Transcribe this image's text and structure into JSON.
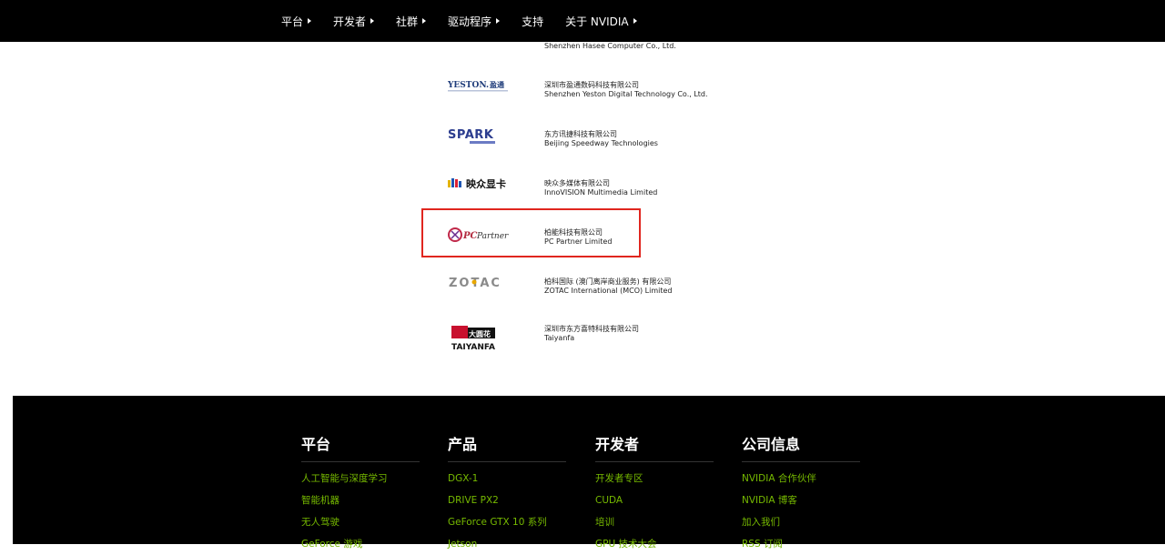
{
  "nav": {
    "items": [
      {
        "label": "平台",
        "caret": true
      },
      {
        "label": "开发者",
        "caret": true
      },
      {
        "label": "社群",
        "caret": true
      },
      {
        "label": "驱动程序",
        "caret": true
      },
      {
        "label": "支持",
        "caret": false
      },
      {
        "label": "关于 NVIDIA",
        "caret": true
      }
    ]
  },
  "partners": {
    "top_partial": "Shenzhen Hasee Computer Co., Ltd.",
    "items": [
      {
        "logo": "YESTON. 盈通",
        "cn": "深圳市盈通数码科技有限公司",
        "en": "Shenzhen Yeston Digital Technology Co., Ltd."
      },
      {
        "logo": "SPARK",
        "cn": "东方讯捷科技有限公司",
        "en": "Beijing Speedway Technologies"
      },
      {
        "logo": "映众显卡",
        "cn": "映众多媒体有限公司",
        "en": "InnoVISION Multimedia Limited"
      },
      {
        "logo": "PCPartner",
        "cn": "柏能科技有限公司",
        "en": "PC Partner Limited"
      },
      {
        "logo": "ZOTAC",
        "cn": "柏科国际 (澳门离岸商业服务) 有限公司",
        "en": "ZOTAC International (MCO) Limited"
      },
      {
        "logo": "TAIYANFA",
        "cn": "深圳市东方喜特科技有限公司",
        "en": "Taiyanfa"
      }
    ]
  },
  "footer": {
    "columns": [
      {
        "heading": "平台",
        "links": [
          "人工智能与深度学习",
          "智能机器",
          "无人驾驶",
          "GeForce 游戏"
        ]
      },
      {
        "heading": "产品",
        "links": [
          "DGX-1",
          "DRIVE PX2",
          "GeForce GTX 10 系列",
          "Jetson"
        ]
      },
      {
        "heading": "开发者",
        "links": [
          "开发者专区",
          "CUDA",
          "培训",
          "GPU 技术大会"
        ]
      },
      {
        "heading": "公司信息",
        "links": [
          "NVIDIA 合作伙伴",
          "NVIDIA 博客",
          "加入我们",
          "RSS 订阅"
        ]
      }
    ]
  },
  "colors": {
    "accent": "#76b900",
    "highlight": "#e0261f"
  }
}
